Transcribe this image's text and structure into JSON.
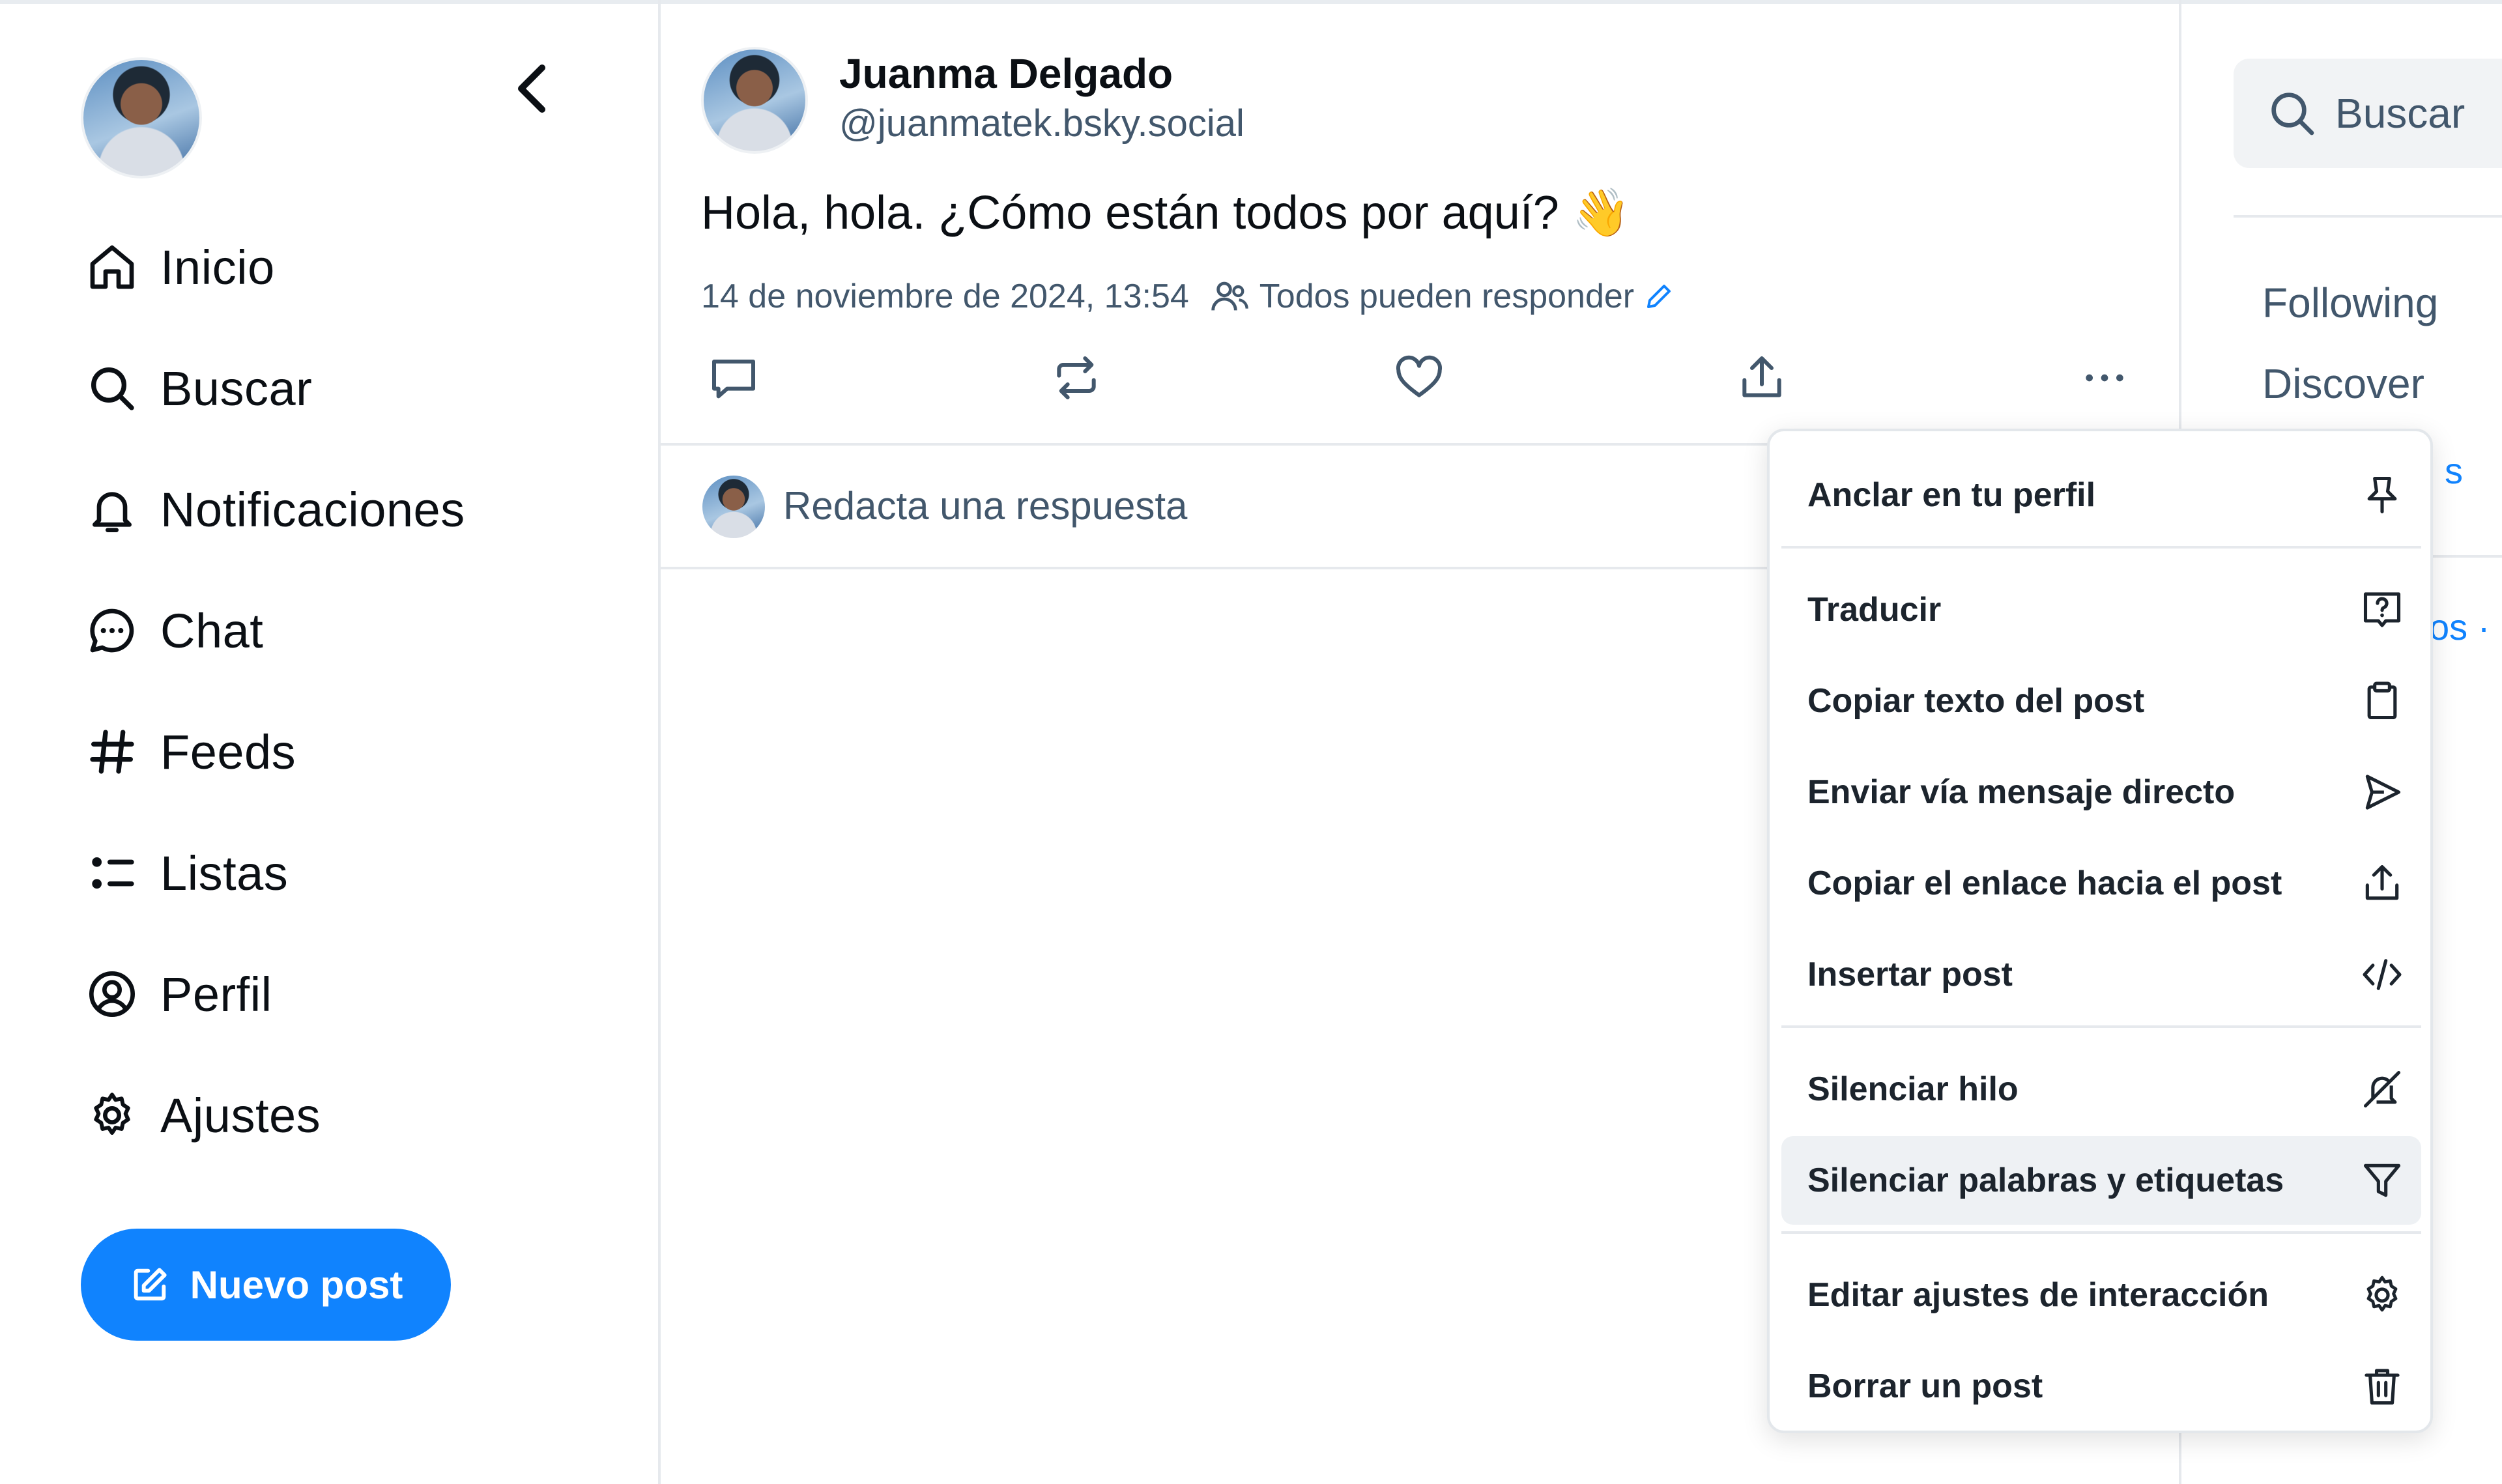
{
  "sidebar": {
    "nav": [
      {
        "label": "Inicio",
        "icon": "home-icon"
      },
      {
        "label": "Buscar",
        "icon": "search-icon"
      },
      {
        "label": "Notificaciones",
        "icon": "bell-icon"
      },
      {
        "label": "Chat",
        "icon": "chat-bubble-icon"
      },
      {
        "label": "Feeds",
        "icon": "hashtag-icon"
      },
      {
        "label": "Listas",
        "icon": "list-icon"
      },
      {
        "label": "Perfil",
        "icon": "user-circle-icon"
      },
      {
        "label": "Ajustes",
        "icon": "gear-icon"
      }
    ],
    "new_post_label": "Nuevo post"
  },
  "post": {
    "author_name": "Juanma Delgado",
    "author_handle": "@juanmatek.bsky.social",
    "text": "Hola, hola. ¿Cómo están todos por aquí? 👋",
    "timestamp": "14 de noviembre de 2024, 13:54",
    "reply_setting": "Todos pueden responder"
  },
  "reply": {
    "placeholder": "Redacta una respuesta"
  },
  "right": {
    "search_placeholder": "Buscar",
    "feeds": [
      "Following",
      "Discover"
    ],
    "peek_1": "s",
    "peek_2": "os ·"
  },
  "menu": {
    "items": [
      {
        "label": "Anclar en tu perfil",
        "icon": "pin-icon"
      },
      {
        "label": "Traducir",
        "icon": "translate-icon"
      },
      {
        "label": "Copiar texto del post",
        "icon": "clipboard-icon"
      },
      {
        "label": "Enviar vía mensaje directo",
        "icon": "send-icon"
      },
      {
        "label": "Copiar el enlace hacia el post",
        "icon": "share-icon"
      },
      {
        "label": "Insertar post",
        "icon": "code-icon"
      },
      {
        "label": "Silenciar hilo",
        "icon": "mute-icon"
      },
      {
        "label": "Silenciar palabras y etiquetas",
        "icon": "filter-icon"
      },
      {
        "label": "Editar ajustes de interacción",
        "icon": "gear-icon"
      },
      {
        "label": "Borrar un post",
        "icon": "trash-icon"
      }
    ]
  },
  "colors": {
    "accent": "#1083fe",
    "text": "#0b0f14",
    "muted": "#42576c",
    "border": "#e6e9ed",
    "hover": "#eef1f4"
  }
}
